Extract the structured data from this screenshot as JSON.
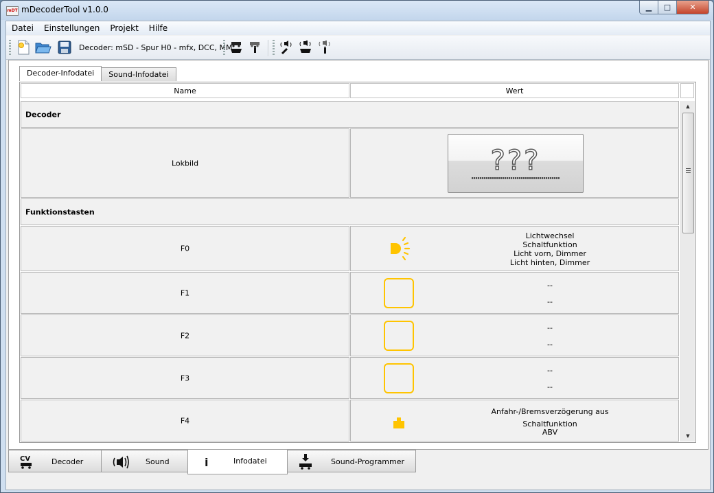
{
  "window": {
    "title": "mDecoderTool v1.0.0",
    "logo_text": "mDT",
    "controls": {
      "minimize": "▁",
      "maximize": "□",
      "close": "✕"
    }
  },
  "menu": [
    "Datei",
    "Einstellungen",
    "Projekt",
    "Hilfe"
  ],
  "toolbar": {
    "decoder_info": "Decoder: mSD - Spur H0 - mfx, DCC, MM",
    "icons": [
      "new-file-icon",
      "open-folder-icon",
      "save-disk-icon",
      "train-export-icon",
      "train-info-icon",
      "sound-tool-icon",
      "sound-export-icon",
      "sound-info-icon"
    ]
  },
  "top_tabs": [
    {
      "label": "Decoder-Infodatei",
      "active": true
    },
    {
      "label": "Sound-Infodatei",
      "active": false
    }
  ],
  "table": {
    "headers": {
      "name": "Name",
      "value": "Wert"
    },
    "sections": {
      "decoder": "Decoder",
      "functions": "Funktionstasten"
    },
    "lokbild": {
      "label": "Lokbild",
      "placeholder": "???"
    },
    "functions": [
      {
        "key": "F0",
        "icon": "light-icon",
        "lines": [
          "Lichtwechsel",
          "Schaltfunktion",
          "Licht vorn, Dimmer",
          "Licht hinten, Dimmer"
        ]
      },
      {
        "key": "F1",
        "icon": "empty-function-icon",
        "lines": [
          "--",
          "--"
        ]
      },
      {
        "key": "F2",
        "icon": "empty-function-icon",
        "lines": [
          "--",
          "--"
        ]
      },
      {
        "key": "F3",
        "icon": "empty-function-icon",
        "lines": [
          "--",
          "--"
        ]
      },
      {
        "key": "F4",
        "icon": "weight-icon",
        "lines": [
          "Anfahr-/Bremsverzögerung aus",
          "Schaltfunktion",
          "ABV"
        ]
      }
    ]
  },
  "bottom_tabs": [
    {
      "label": "Decoder",
      "icon": "cv-train-icon",
      "icon_text": "CV",
      "active": false
    },
    {
      "label": "Sound",
      "icon": "speaker-icon",
      "active": false
    },
    {
      "label": "Infodatei",
      "icon": "info-icon",
      "icon_text": "i",
      "active": true
    },
    {
      "label": "Sound-Programmer",
      "icon": "download-train-icon",
      "active": false
    }
  ],
  "colors": {
    "accent_yellow": "#ffc400",
    "title_bar": "#c3d6ec",
    "close_red": "#c4442b"
  }
}
